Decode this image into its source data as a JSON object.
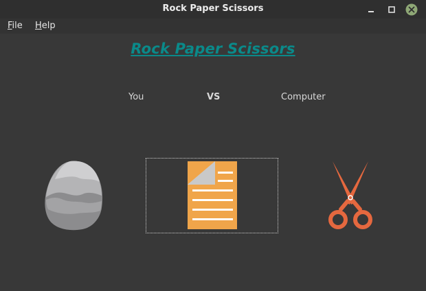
{
  "window": {
    "title": "Rock Paper Scissors"
  },
  "menu": {
    "file_letter": "F",
    "file_rest": "ile",
    "help_letter": "H",
    "help_rest": "elp"
  },
  "game": {
    "heading": "Rock Paper Scissors",
    "player_label": "You",
    "vs_label": "VS",
    "opponent_label": "Computer",
    "choices": [
      "rock",
      "paper",
      "scissors"
    ],
    "focused_choice": "paper"
  },
  "colors": {
    "heading": "#0a8a8a",
    "paper": "#f0a54a",
    "scissors": "#e5683f",
    "rock": "#b4b4b6",
    "close_button": "#8fa876"
  },
  "icons": {
    "minimize": "minimize-icon",
    "maximize": "maximize-icon",
    "close": "close-icon"
  }
}
